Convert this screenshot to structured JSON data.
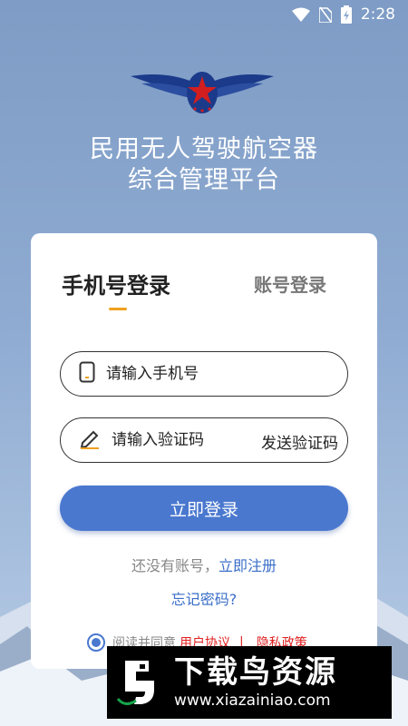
{
  "status_bar": {
    "time": "2:28"
  },
  "header": {
    "title_line1": "民用无人驾驶航空器",
    "title_line2": "综合管理平台"
  },
  "tabs": [
    {
      "label": "手机号登录",
      "active": true
    },
    {
      "label": "账号登录",
      "active": false
    }
  ],
  "form": {
    "phone_placeholder": "请输入手机号",
    "code_placeholder": "请输入验证码",
    "send_code_label": "发送验证码",
    "login_label": "立即登录"
  },
  "links": {
    "no_account_text": "还没有账号，",
    "register_label": "立即注册",
    "forgot_label": "忘记密码?"
  },
  "agreement": {
    "prefix": "阅读并同意",
    "user_agreement": "用户协议",
    "separator": "|",
    "privacy_policy": "隐私政策"
  },
  "watermark": {
    "title": "下载鸟资源",
    "url": "www.xiazainiao.com"
  },
  "colors": {
    "primary": "#4a78cf",
    "accent": "#f0a020",
    "link": "#3a6ec8",
    "danger": "#e02020"
  }
}
